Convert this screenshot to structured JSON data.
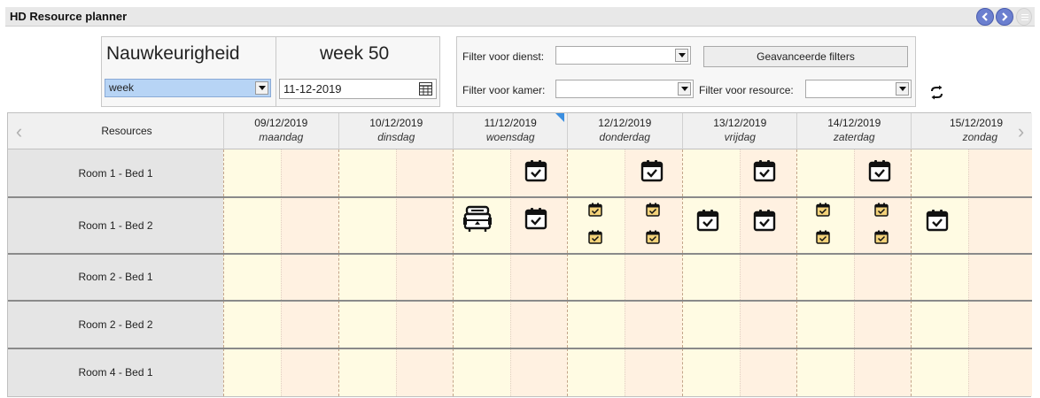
{
  "window": {
    "title": "HD Resource planner"
  },
  "precision": {
    "label": "Nauwkeurigheid",
    "week_label": "week 50",
    "select_value": "week",
    "date_value": "11-12-2019"
  },
  "filters": {
    "dienst_label": "Filter voor dienst:",
    "kamer_label": "Filter voor kamer:",
    "resource_label": "Filter voor resource:",
    "dienst_value": "",
    "kamer_value": "",
    "resource_value": "",
    "advanced_button": "Geavanceerde filters"
  },
  "grid": {
    "resources_header": "Resources",
    "days": [
      {
        "date": "09/12/2019",
        "name": "maandag"
      },
      {
        "date": "10/12/2019",
        "name": "dinsdag"
      },
      {
        "date": "11/12/2019",
        "name": "woensdag"
      },
      {
        "date": "12/12/2019",
        "name": "donderdag"
      },
      {
        "date": "13/12/2019",
        "name": "vrijdag"
      },
      {
        "date": "14/12/2019",
        "name": "zaterdag"
      },
      {
        "date": "15/12/2019",
        "name": "zondag"
      }
    ],
    "rows": [
      {
        "label": "Room 1 - Bed 1"
      },
      {
        "label": "Room 1 - Bed 2"
      },
      {
        "label": "Room 2 - Bed 1"
      },
      {
        "label": "Room 2 - Bed 2"
      },
      {
        "label": "Room 4 - Bed 1"
      }
    ]
  },
  "icons": {
    "nav_prev": "chevron-left-icon",
    "nav_next": "chevron-right-icon",
    "menu": "menu-icon",
    "calendar": "calendar-icon",
    "refresh": "refresh-icon",
    "appointment": "calendar-check-icon",
    "machine": "dialysis-machine-icon"
  },
  "colors": {
    "nav_button": "#6b7fcf",
    "select_highlight": "#b7d4f5",
    "cell_yellow": "#fffbe3",
    "cell_peach": "#fff1e1",
    "event_small_fill": "#f3d27a",
    "current_day_marker": "#3c8fe0"
  }
}
